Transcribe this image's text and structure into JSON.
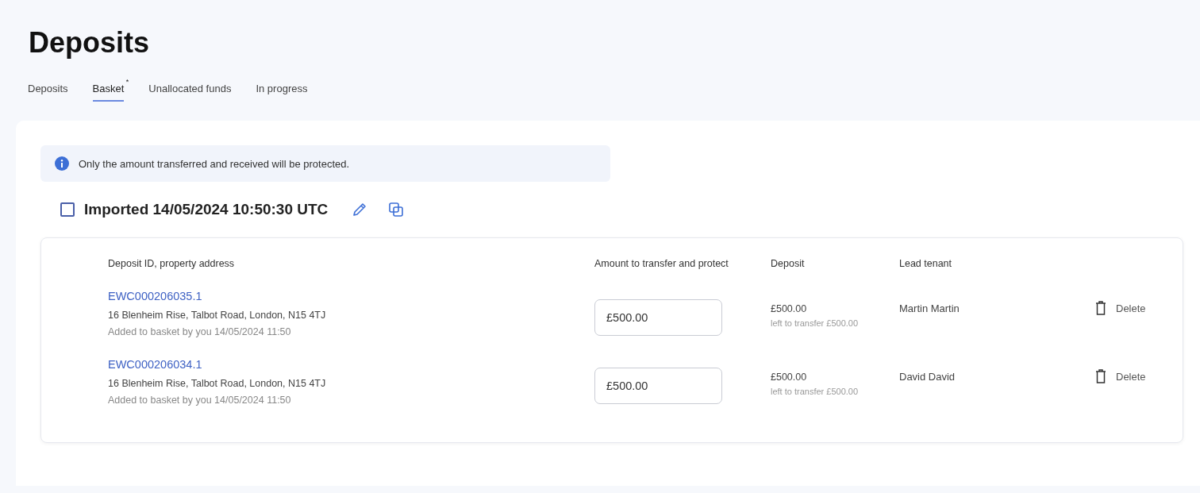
{
  "page": {
    "title": "Deposits"
  },
  "tabs": [
    {
      "label": "Deposits",
      "selected": false
    },
    {
      "label": "Basket",
      "selected": true,
      "badge": "*"
    },
    {
      "label": "Unallocated funds",
      "selected": false
    },
    {
      "label": "In progress",
      "selected": false
    }
  ],
  "notice": {
    "text": "Only the amount transferred and received will be protected."
  },
  "group": {
    "title": "Imported 14/05/2024 10:50:30 UTC",
    "checked": false
  },
  "table": {
    "columns": [
      "Deposit ID, property address",
      "Amount to transfer and protect",
      "Deposit",
      "Lead tenant"
    ],
    "rows": [
      {
        "deposit_id": "EWC000206035.1",
        "address": "16 Blenheim Rise, Talbot Road, London, N15 4TJ",
        "added": "Added to basket by you 14/05/2024 11:50",
        "amount": "£500.00",
        "deposit": "£500.00",
        "left": "left to transfer £500.00",
        "tenant": "Martin Martin",
        "action": "Delete"
      },
      {
        "deposit_id": "EWC000206034.1",
        "address": "16 Blenheim Rise, Talbot Road, London, N15 4TJ",
        "added": "Added to basket by you 14/05/2024 11:50",
        "amount": "£500.00",
        "deposit": "£500.00",
        "left": "left to transfer £500.00",
        "tenant": "David David",
        "action": "Delete"
      }
    ]
  }
}
